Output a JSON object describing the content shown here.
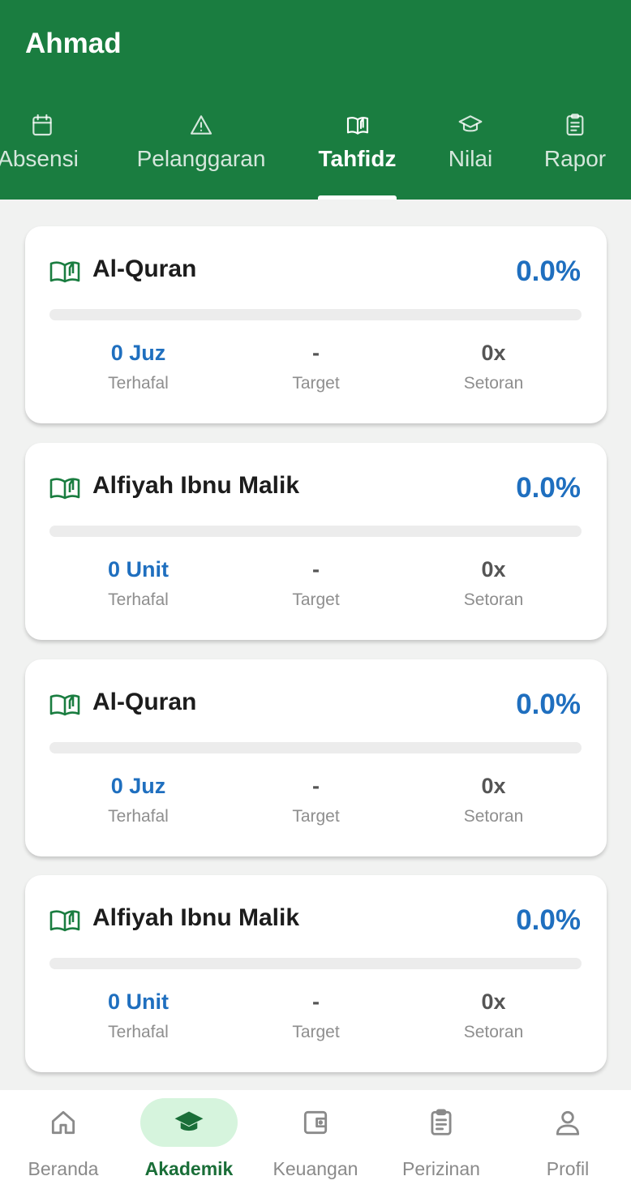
{
  "header": {
    "title": "Ahmad"
  },
  "tabs": [
    {
      "label": "Absensi",
      "icon": "calendar-icon"
    },
    {
      "label": "Pelanggaran",
      "icon": "warning-icon"
    },
    {
      "label": "Tahfidz",
      "icon": "open-book-icon",
      "active": true
    },
    {
      "label": "Nilai",
      "icon": "graduation-cap-icon"
    },
    {
      "label": "Rapor",
      "icon": "clipboard-icon"
    }
  ],
  "cards": [
    {
      "title": "Al-Quran",
      "percent": "0.0%",
      "progress": 0.0,
      "terhafal": "0 Juz",
      "target": "-",
      "setoran": "0x",
      "label_terhafal": "Terhafal",
      "label_target": "Target",
      "label_setoran": "Setoran"
    },
    {
      "title": "Alfiyah Ibnu Malik",
      "percent": "0.0%",
      "progress": 0.0,
      "terhafal": "0 Unit",
      "target": "-",
      "setoran": "0x",
      "label_terhafal": "Terhafal",
      "label_target": "Target",
      "label_setoran": "Setoran"
    },
    {
      "title": "Al-Quran",
      "percent": "0.0%",
      "progress": 0.0,
      "terhafal": "0 Juz",
      "target": "-",
      "setoran": "0x",
      "label_terhafal": "Terhafal",
      "label_target": "Target",
      "label_setoran": "Setoran"
    },
    {
      "title": "Alfiyah Ibnu Malik",
      "percent": "0.0%",
      "progress": 0.0,
      "terhafal": "0 Unit",
      "target": "-",
      "setoran": "0x",
      "label_terhafal": "Terhafal",
      "label_target": "Target",
      "label_setoran": "Setoran"
    }
  ],
  "bottom_nav": [
    {
      "label": "Beranda",
      "icon": "home-icon"
    },
    {
      "label": "Akademik",
      "icon": "graduation-cap-icon",
      "active": true
    },
    {
      "label": "Keuangan",
      "icon": "wallet-icon"
    },
    {
      "label": "Perizinan",
      "icon": "clipboard-icon"
    },
    {
      "label": "Profil",
      "icon": "person-icon"
    }
  ],
  "colors": {
    "primary_green": "#1a7d40",
    "accent_blue": "#1f6fbf",
    "nav_active_bg": "#d6f4dd",
    "nav_active_fg": "#1a6e38"
  }
}
